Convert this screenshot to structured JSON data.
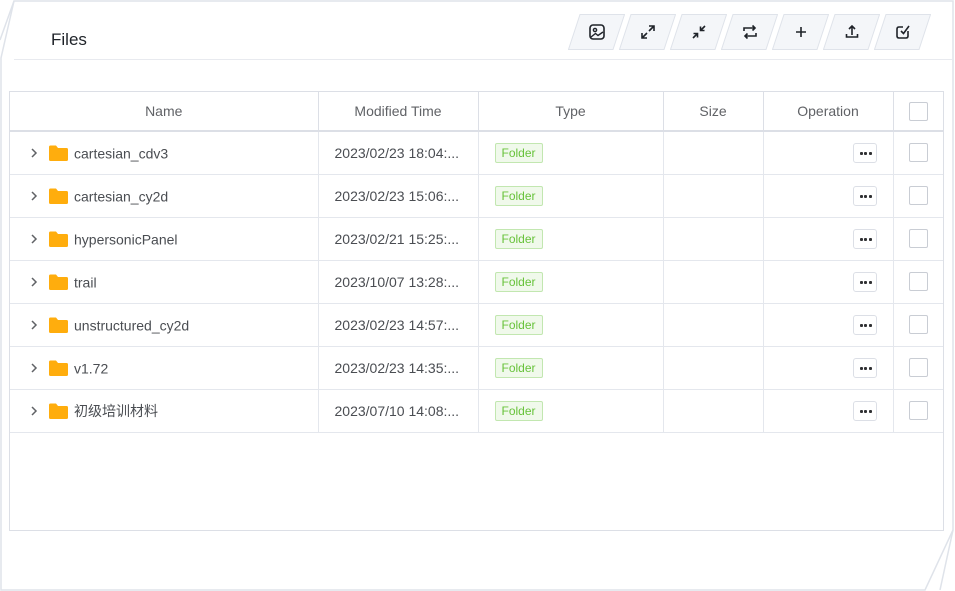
{
  "header": {
    "title": "Files"
  },
  "toolbar": {
    "buttons": [
      {
        "icon": "image-icon"
      },
      {
        "icon": "expand-icon"
      },
      {
        "icon": "collapse-icon"
      },
      {
        "icon": "refresh-icon"
      },
      {
        "icon": "plus-icon"
      },
      {
        "icon": "upload-icon"
      },
      {
        "icon": "checkbox-icon"
      }
    ]
  },
  "table": {
    "columns": {
      "name": "Name",
      "modified": "Modified Time",
      "type": "Type",
      "size": "Size",
      "operation": "Operation"
    },
    "rows": [
      {
        "name": "cartesian_cdv3",
        "modified": "2023/02/23 18:04:...",
        "type": "Folder",
        "size": ""
      },
      {
        "name": "cartesian_cy2d",
        "modified": "2023/02/23 15:06:...",
        "type": "Folder",
        "size": ""
      },
      {
        "name": "hypersonicPanel",
        "modified": "2023/02/21 15:25:...",
        "type": "Folder",
        "size": ""
      },
      {
        "name": "trail",
        "modified": "2023/10/07 13:28:...",
        "type": "Folder",
        "size": ""
      },
      {
        "name": "unstructured_cy2d",
        "modified": "2023/02/23 14:57:...",
        "type": "Folder",
        "size": ""
      },
      {
        "name": "v1.72",
        "modified": "2023/02/23 14:35:...",
        "type": "Folder",
        "size": ""
      },
      {
        "name": "初级培训材料",
        "modified": "2023/07/10 14:08:...",
        "type": "Folder",
        "size": ""
      }
    ]
  },
  "colors": {
    "folder": "#ffad0d",
    "tag_text": "#67c23a",
    "tag_bg": "#f0f9eb",
    "border": "#dcdfe6"
  }
}
